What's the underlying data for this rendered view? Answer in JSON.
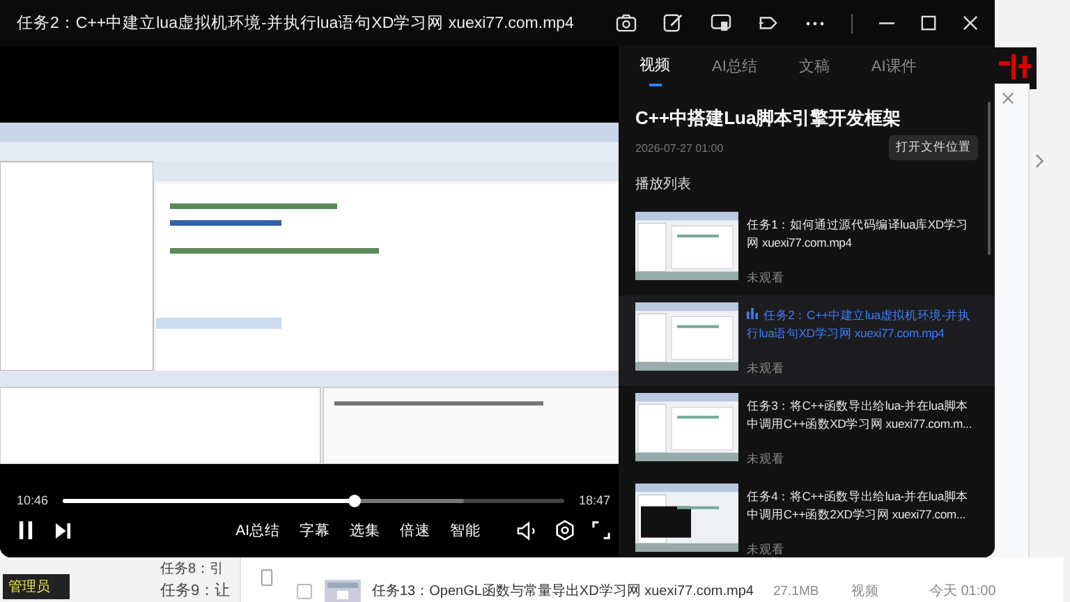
{
  "window": {
    "title": "任务2：C++中建立lua虚拟机环境-并执行lua语句XD学习网 xuexi77.com.mp4"
  },
  "player": {
    "elapsed": "10:46",
    "duration": "18:47",
    "level": 0.58,
    "playing": true,
    "buttons": [
      "AI总结",
      "字幕",
      "选集",
      "倍速",
      "智能"
    ]
  },
  "panel": {
    "tabs": [
      {
        "label": "视频",
        "selected": true
      },
      {
        "label": "AI总结",
        "selected": false
      },
      {
        "label": "文稿",
        "selected": false
      },
      {
        "label": "AI课件",
        "selected": false
      }
    ],
    "course_title": "C++中搭建Lua脚本引擎开发框架",
    "date": "2026-07-27 01:00",
    "open_button": "打开文件位置",
    "playlist_heading": "播放列表",
    "items": [
      {
        "title": "任务1：如何通过源代码编译lua库XD学习网 xuexi77.com.mp4",
        "status": "未观看",
        "selected": false
      },
      {
        "title": "任务2：C++中建立lua虚拟机环境-并执行lua语句XD学习网 xuexi77.com.mp4",
        "status": "未观看",
        "selected": true
      },
      {
        "title": "任务3：将C++函数导出给lua-并在lua脚本中调用C++函数XD学习网 xuexi77.com.m...",
        "status": "未观看",
        "selected": false
      },
      {
        "title": "任务4：将C++函数导出给lua-并在lua脚本中调用C++函数2XD学习网 xuexi77.com...",
        "status": "未观看",
        "selected": false
      }
    ]
  },
  "background": {
    "badge": "管理员",
    "tasks": [
      "任务8：引",
      "任务9：让"
    ],
    "file_row": {
      "checked": false,
      "name": "任务13：OpenGL函数与常量导出XD学习网 xuexi77.com.mp4",
      "size": "27.1MB",
      "type": "视频",
      "time": "今天 01:00"
    }
  }
}
